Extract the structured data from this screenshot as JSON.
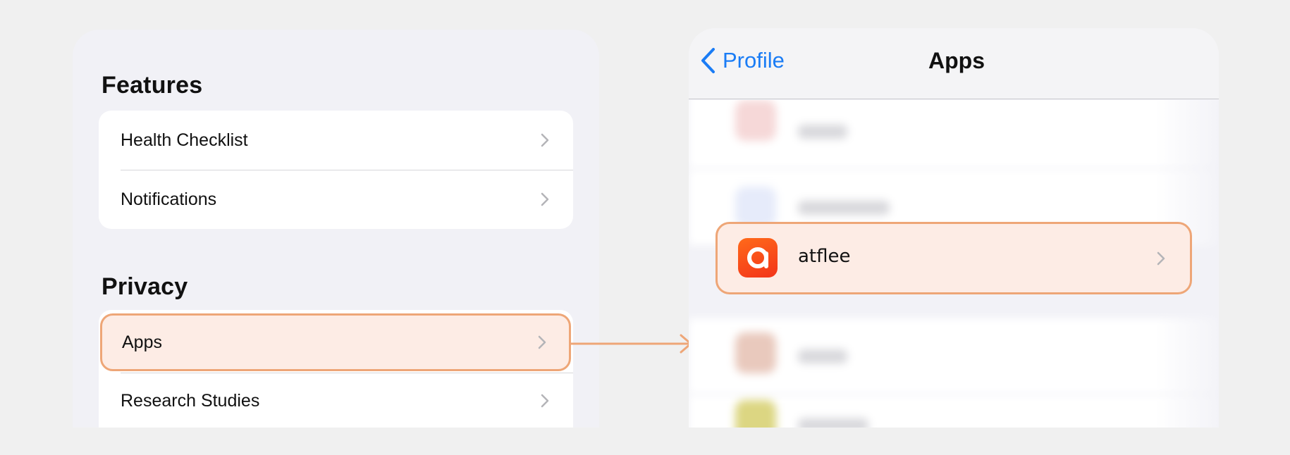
{
  "left": {
    "features_title": "Features",
    "features_items": [
      {
        "label": "Health Checklist"
      },
      {
        "label": "Notifications"
      }
    ],
    "privacy_title": "Privacy",
    "privacy_items": [
      {
        "label": "Apps",
        "highlighted": true
      },
      {
        "label": "Research Studies"
      }
    ]
  },
  "right": {
    "back_label": "Profile",
    "title": "Apps",
    "selected_app": {
      "name": "atflee",
      "icon": "atflee-app-icon"
    }
  },
  "colors": {
    "highlight_fill": "#fdece5",
    "highlight_border": "#eea677",
    "ios_blue": "#1a7cf5",
    "app_icon": "#f4461a"
  }
}
